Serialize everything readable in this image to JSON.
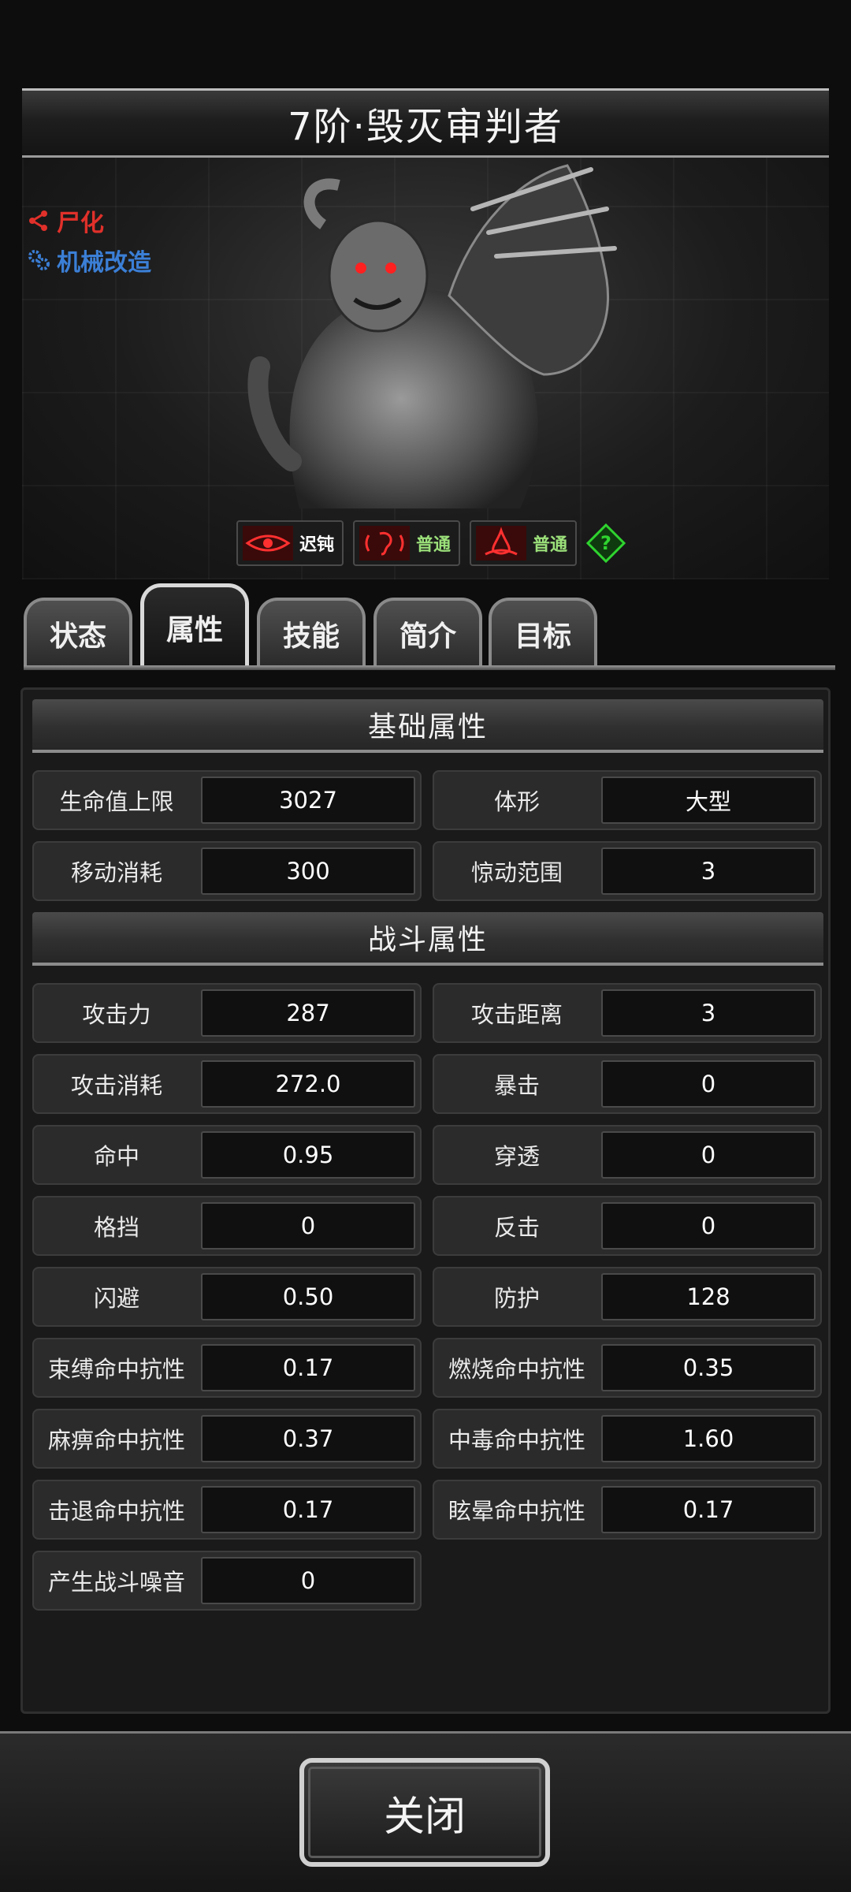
{
  "monster": {
    "title": "7阶·毁灭审判者",
    "traits": [
      {
        "label": "尸化",
        "icon": "share-icon",
        "color": "#e0302a"
      },
      {
        "label": "机械改造",
        "icon": "gear-cluster-icon",
        "color": "#3b7fd6"
      }
    ],
    "senses": [
      {
        "icon": "eye-icon",
        "label": "迟钝",
        "color": "#ffffff"
      },
      {
        "icon": "ear-icon",
        "label": "普通",
        "color": "#9be07a"
      },
      {
        "icon": "nose-icon",
        "label": "普通",
        "color": "#9be07a"
      }
    ]
  },
  "tabs": [
    {
      "label": "状态"
    },
    {
      "label": "属性",
      "active": true
    },
    {
      "label": "技能"
    },
    {
      "label": "简介"
    },
    {
      "label": "目标"
    }
  ],
  "sections": {
    "basic_title": "基础属性",
    "combat_title": "战斗属性"
  },
  "basic_stats": [
    {
      "label": "生命值上限",
      "value": "3027"
    },
    {
      "label": "体形",
      "value": "大型"
    },
    {
      "label": "移动消耗",
      "value": "300"
    },
    {
      "label": "惊动范围",
      "value": "3"
    }
  ],
  "combat_stats": [
    {
      "label": "攻击力",
      "value": "287"
    },
    {
      "label": "攻击距离",
      "value": "3"
    },
    {
      "label": "攻击消耗",
      "value": "272.0"
    },
    {
      "label": "暴击",
      "value": "0"
    },
    {
      "label": "命中",
      "value": "0.95"
    },
    {
      "label": "穿透",
      "value": "0"
    },
    {
      "label": "格挡",
      "value": "0"
    },
    {
      "label": "反击",
      "value": "0"
    },
    {
      "label": "闪避",
      "value": "0.50"
    },
    {
      "label": "防护",
      "value": "128"
    },
    {
      "label": "束缚命中抗性",
      "value": "0.17"
    },
    {
      "label": "燃烧命中抗性",
      "value": "0.35"
    },
    {
      "label": "麻痹命中抗性",
      "value": "0.37"
    },
    {
      "label": "中毒命中抗性",
      "value": "1.60"
    },
    {
      "label": "击退命中抗性",
      "value": "0.17"
    },
    {
      "label": "眩晕命中抗性",
      "value": "0.17"
    },
    {
      "label": "产生战斗噪音",
      "value": "0"
    }
  ],
  "footer": {
    "close_label": "关闭"
  }
}
